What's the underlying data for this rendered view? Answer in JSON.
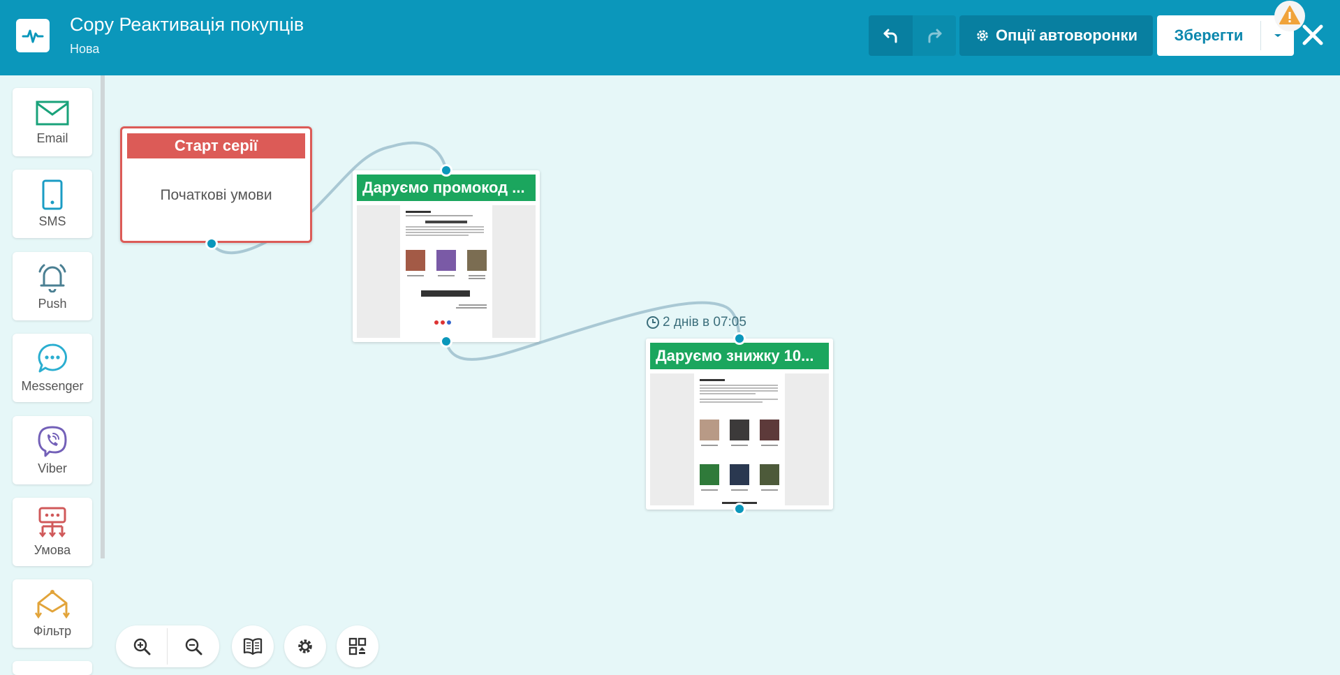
{
  "header": {
    "title": "Copy Реактивація покупців",
    "status": "Нова",
    "options_label": "Опції автоворонки",
    "save_label": "Зберегти"
  },
  "sidebar": {
    "items": [
      {
        "label": "Email",
        "icon": "envelope-icon"
      },
      {
        "label": "SMS",
        "icon": "phone-icon"
      },
      {
        "label": "Push",
        "icon": "bell-icon"
      },
      {
        "label": "Messenger",
        "icon": "chat-icon"
      },
      {
        "label": "Viber",
        "icon": "viber-icon"
      },
      {
        "label": "Умова",
        "icon": "condition-icon"
      },
      {
        "label": "Фільтр",
        "icon": "filter-icon"
      }
    ]
  },
  "nodes": {
    "start": {
      "title": "Старт серії",
      "body": "Початкові умови"
    },
    "email1": {
      "title": "Даруємо промокод ..."
    },
    "email2": {
      "title": "Даруємо знижку 10...",
      "delay": "2 днів в 07:05"
    }
  },
  "colors": {
    "header": "#0b97bb",
    "canvas": "#e6f7f8",
    "start": "#dc5b57",
    "email_head": "#1ba65e",
    "port": "#0b97bb"
  }
}
